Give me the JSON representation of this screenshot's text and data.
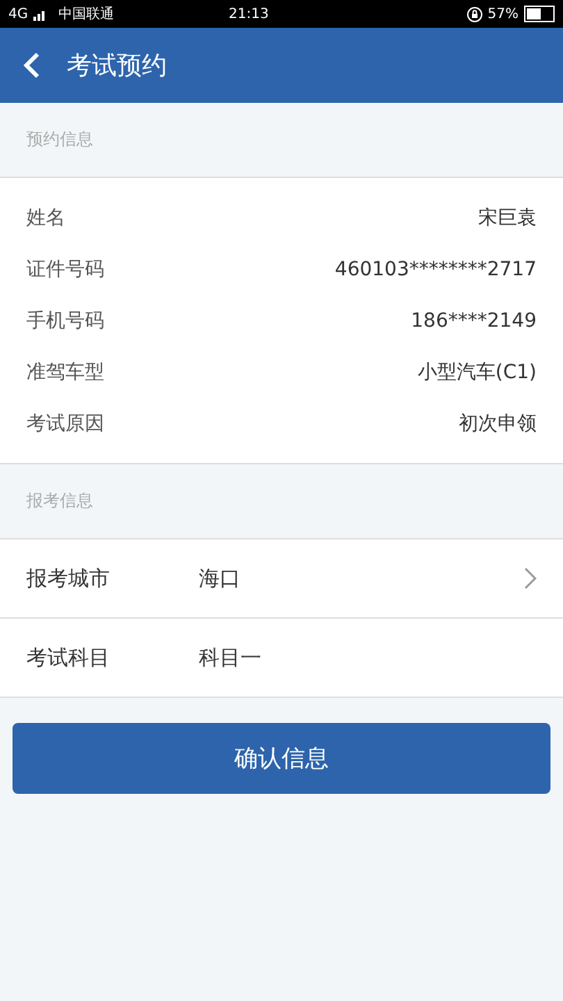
{
  "status_bar": {
    "network": "4G",
    "carrier": "中国联通",
    "time": "21:13",
    "battery": "57%"
  },
  "header": {
    "title": "考试预约"
  },
  "sections": [
    {
      "title": "预约信息",
      "kind": "info",
      "rows": [
        {
          "label": "姓名",
          "value": "宋巨袁"
        },
        {
          "label": "证件号码",
          "value": "460103********2717"
        },
        {
          "label": "手机号码",
          "value": "186****2149"
        },
        {
          "label": "准驾车型",
          "value": "小型汽车(C1)"
        },
        {
          "label": "考试原因",
          "value": "初次申领"
        }
      ]
    },
    {
      "title": "报考信息",
      "kind": "form",
      "rows": [
        {
          "label": "报考城市",
          "value": "海口",
          "chevron": true
        },
        {
          "label": "考试科目",
          "value": "科目一",
          "chevron": false
        }
      ]
    }
  ],
  "confirm_button": "确认信息"
}
